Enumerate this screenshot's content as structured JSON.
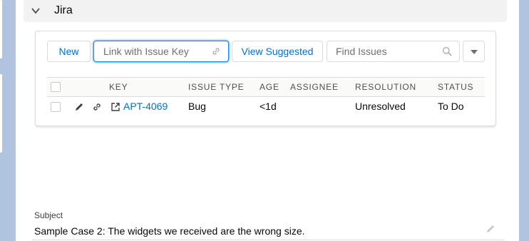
{
  "section": {
    "title": "Jira",
    "chevron_icon": "chevron-down-icon"
  },
  "toolbar": {
    "new_label": "New",
    "link_placeholder": "Link with Issue Key",
    "link_icon": "link-icon",
    "suggest_label": "View Suggested",
    "find_placeholder": "Find Issues",
    "search_icon": "search-icon",
    "menu_icon": "caret-down-icon"
  },
  "table": {
    "headers": [
      "KEY",
      "ISSUE TYPE",
      "AGE",
      "ASSIGNEE",
      "RESOLUTION",
      "STATUS"
    ],
    "rows": [
      {
        "key": "APT-4069",
        "issue_type": "Bug",
        "age": "<1d",
        "assignee": "",
        "resolution": "Unresolved",
        "status": "To Do",
        "icons": [
          "edit-icon",
          "link-icon",
          "external-link-icon"
        ]
      }
    ]
  },
  "subject": {
    "label": "Subject",
    "value": "Sample Case 2: The widgets we received are the wrong size.",
    "edit_icon": "edit-icon"
  },
  "colors": {
    "link": "#0070d2",
    "border": "#dddbda",
    "background": "#b0c4df"
  }
}
